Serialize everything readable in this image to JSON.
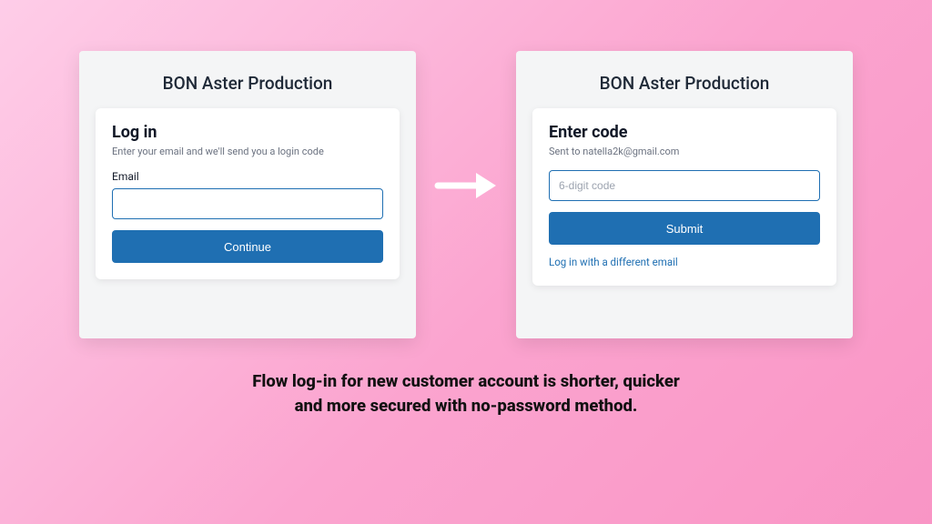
{
  "brand": "BON Aster Production",
  "left": {
    "heading": "Log in",
    "sub": "Enter your email and we'll send you a login code",
    "field_label": "Email",
    "placeholder": "",
    "button": "Continue"
  },
  "right": {
    "heading": "Enter code",
    "sub": "Sent to natella2k@gmail.com",
    "placeholder": "6-digit code",
    "button": "Submit",
    "link": "Log in with a different email"
  },
  "caption_line1": "Flow log-in for new customer account is shorter, quicker",
  "caption_line2": "and more secured with no-password method."
}
